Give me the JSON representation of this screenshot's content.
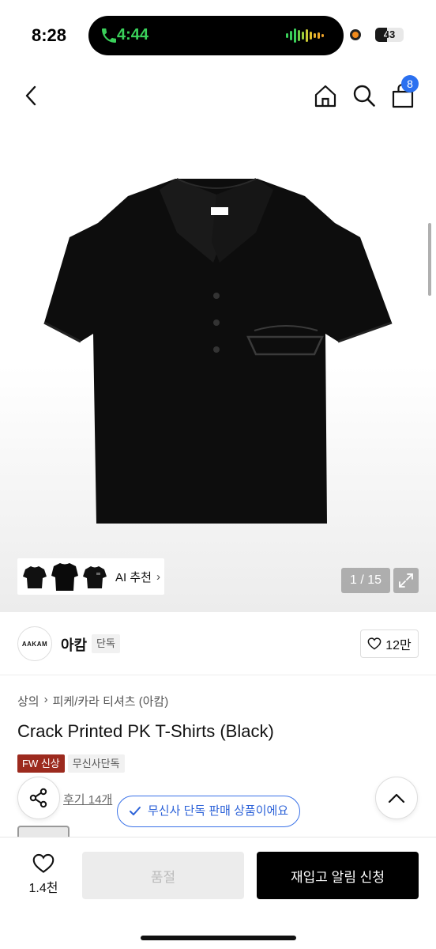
{
  "status_bar": {
    "time": "8:28",
    "call_time": "4:44",
    "battery_level": 43,
    "battery_text": "43"
  },
  "nav": {
    "back_icon": "chevron-left-icon",
    "home_icon": "home-icon",
    "search_icon": "search-icon",
    "cart_icon": "shopping-bag-icon",
    "cart_count": "8"
  },
  "gallery": {
    "ai_reco_label": "AI 추천",
    "counter": "1 / 15",
    "expand_icon": "expand-icon"
  },
  "brand": {
    "logo_text": "AAKAM",
    "name": "아캄",
    "exclusive_tag": "단독",
    "like_count": "12만"
  },
  "product": {
    "breadcrumb": [
      "상의",
      "피케/카라 티셔츠 (아캄)"
    ],
    "title": "Crack Printed PK T-Shirts (Black)",
    "tag_fw": "FW 신상",
    "tag_exclusive": "무신사단독",
    "reviews": "후기 14개"
  },
  "toast": {
    "text": "무신사 단독 판매 상품이에요"
  },
  "bottom_bar": {
    "wish_count": "1.4천",
    "soldout_label": "품절",
    "restock_label": "재입고 알림 신청"
  },
  "colors": {
    "accent_blue": "#2b70f0",
    "fw_tag_red": "#9c2a1e",
    "call_green": "#3ad05a"
  }
}
